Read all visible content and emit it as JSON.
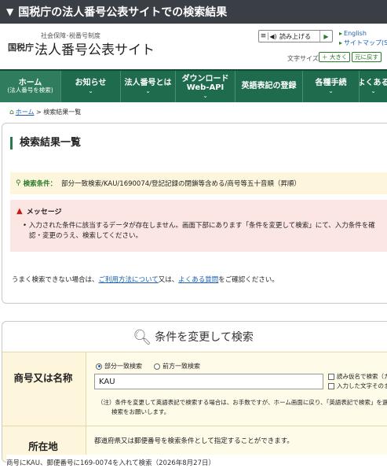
{
  "topbar": {
    "title": "国税庁の法人番号公表サイトでの検索結果"
  },
  "header": {
    "org": "国税庁",
    "sub": "社会保障･税番号制度",
    "title": "法人番号公表サイト",
    "tts_label": "読み上げる",
    "link_english": "English",
    "link_sitemap": "サイトマップ(S)",
    "font_size_label": "文字サイズ",
    "font_bigger": "大きく",
    "font_reset": "元に戻す"
  },
  "nav": {
    "items": [
      {
        "label": "ホーム",
        "sub": "(法人番号を検索)"
      },
      {
        "label": "お知らせ"
      },
      {
        "label": "法人番号とは"
      },
      {
        "label": "ダウンロード",
        "sub": "Web-API"
      },
      {
        "label": "英語表記の登録"
      },
      {
        "label": "各種手続"
      },
      {
        "label": "よくある"
      }
    ]
  },
  "breadcrumb": {
    "home": "ホーム",
    "current": "検索結果一覧"
  },
  "result": {
    "title": "検索結果一覧",
    "condition_label": "検索条件：",
    "condition_text": "部分一致検索/KAU/1690074/登記記録の閉鎖等含める/商号等五十音順（昇順）",
    "message_title": "メッセージ",
    "message_line1": "入力された条件に該当するデータが存在しません。画面下部にあります「条件を変更して検索」にて、入力条件を確",
    "message_line2": "認・変更のうえ、検索してください。",
    "help_prefix": "うまく検索できない場合は、",
    "help_link1": "ご利用方法について",
    "help_mid": "又は、",
    "help_link2": "よくある質問",
    "help_suffix": "をご確認ください。"
  },
  "search": {
    "heading": "条件を変更して検索",
    "name_label": "商号又は名称",
    "radio_partial": "部分一致検索",
    "radio_prefix": "前方一致検索",
    "name_value": "KAU",
    "chk_kana": "読み仮名で検索（カ",
    "chk_input": "入力した文字そのま",
    "note_line1": "（注）条件を変更して英語表記で検索する場合は、お手数ですが、ホーム画面に戻り、「英語表記で検索」を選択",
    "note_line2": "検索をお願いします。",
    "location_label": "所在地",
    "location_text": "都道府県又は郵便番号を検索条件として指定することができます。"
  },
  "caption": "商号にKAU、郵便番号に169-0074を入れて検索（2026年8月27日）"
}
